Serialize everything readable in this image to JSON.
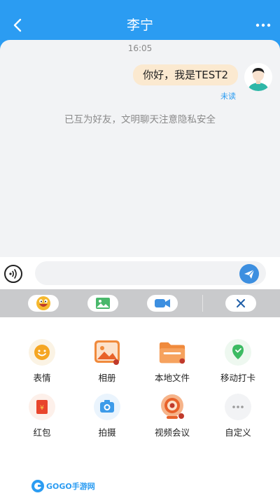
{
  "header": {
    "title": "李宁",
    "back_icon": "chevron-left-icon",
    "more_icon": "ellipsis-icon",
    "color": "#2B9CF2"
  },
  "chat": {
    "timestamp": "16:05",
    "messages": [
      {
        "text": "你好，我是TEST2",
        "status": "未读"
      }
    ],
    "system_note": "已互为好友，文明聊天注意隐私安全"
  },
  "input_bar": {
    "value": "",
    "placeholder": "",
    "voice_icon": "voice-icon",
    "send_icon": "send-icon"
  },
  "quick_bar": {
    "items": [
      "emoji-face-icon",
      "image-icon",
      "video-camera-icon",
      "close-icon"
    ]
  },
  "tools": [
    {
      "label": "表情",
      "icon": "emoji-icon"
    },
    {
      "label": "相册",
      "icon": "album-icon"
    },
    {
      "label": "本地文件",
      "icon": "folder-icon"
    },
    {
      "label": "移动打卡",
      "icon": "location-checkin-icon"
    },
    {
      "label": "红包",
      "icon": "red-packet-icon"
    },
    {
      "label": "拍摄",
      "icon": "camera-icon"
    },
    {
      "label": "视频会议",
      "icon": "video-meeting-icon"
    },
    {
      "label": "自定义",
      "icon": "more-dots-icon"
    }
  ],
  "watermark": {
    "text": "GOGO手游网"
  }
}
